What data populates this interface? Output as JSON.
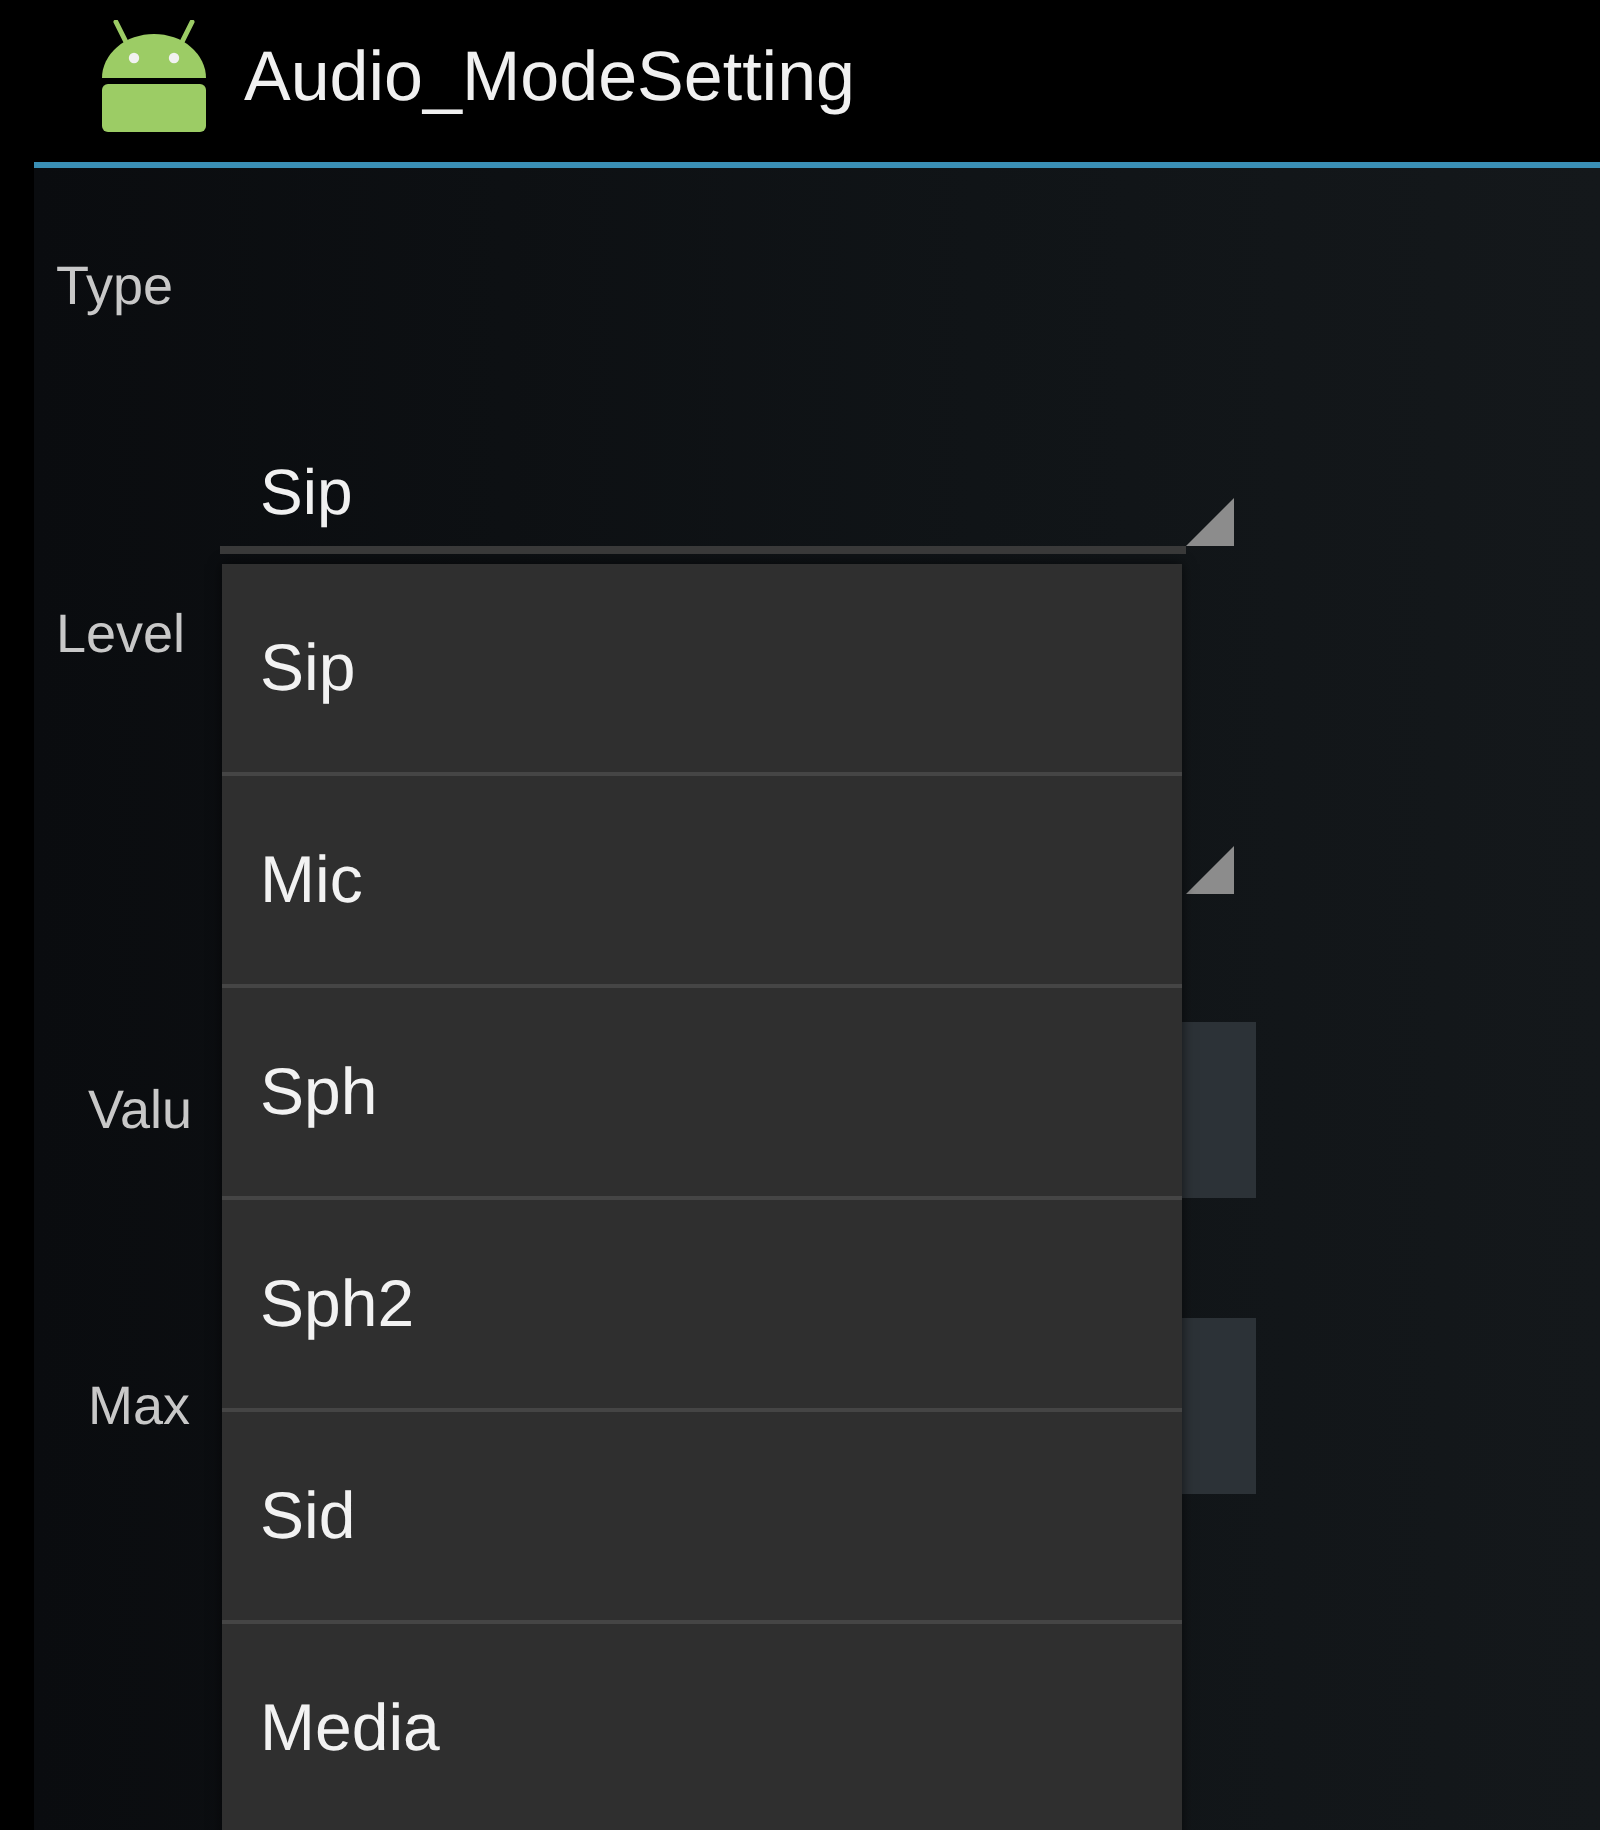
{
  "app_bar": {
    "title": "Audio_ModeSetting"
  },
  "form": [
    {
      "kind": "spinner",
      "label": "Type",
      "value": "Sip"
    },
    {
      "kind": "spinner",
      "label": "Level"
    },
    {
      "kind": "field",
      "label": "Valu"
    },
    {
      "kind": "field",
      "label": "Max"
    }
  ],
  "dropdown": {
    "options": [
      "Sip",
      "Mic",
      "Sph",
      "Sph2",
      "Sid",
      "Media"
    ]
  }
}
